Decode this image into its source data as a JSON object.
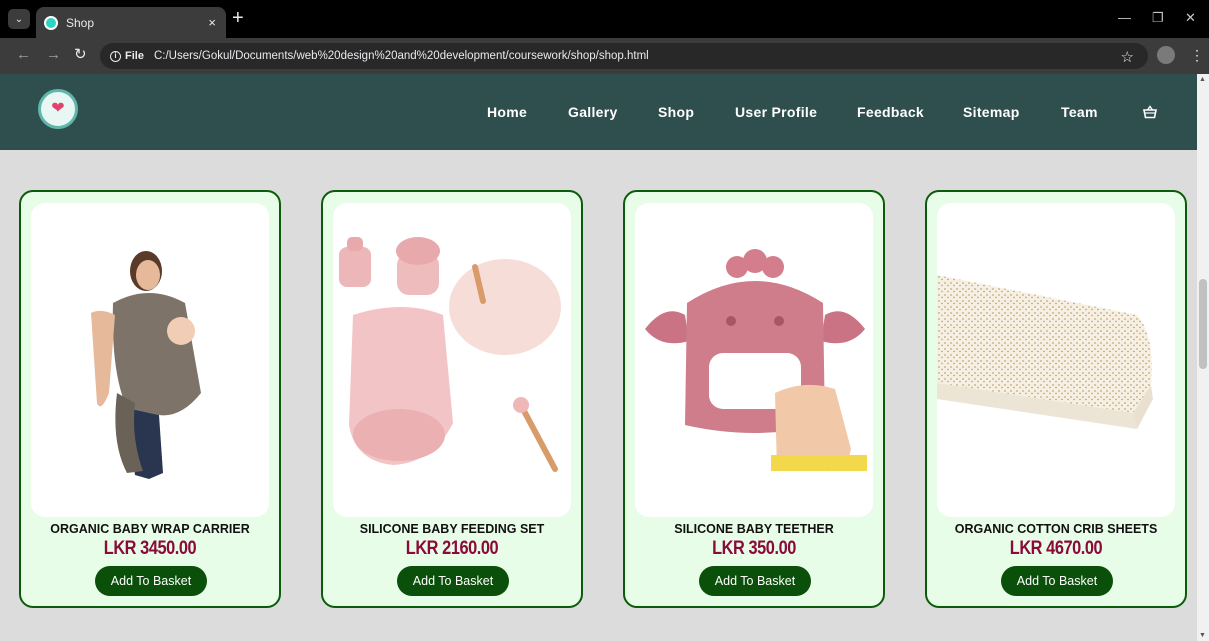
{
  "browser": {
    "tab_title": "Shop",
    "tab_close": "×",
    "new_tab": "+",
    "info_label": "File",
    "url": "C:/Users/Gokul/Documents/web%20design%20and%20development/coursework/shop/shop.html"
  },
  "site": {
    "nav": [
      "Home",
      "Gallery",
      "Shop",
      "User Profile",
      "Feedback",
      "Sitemap",
      "Team"
    ],
    "brand_colors": {
      "header": "#2f4f4f",
      "card_bg": "#e8fde8",
      "card_border": "#0a5c0a",
      "price": "#8b0a3a",
      "button": "#0a4f0a"
    }
  },
  "products": [
    {
      "name": "ORGANIC BABY WRAP CARRIER",
      "price": "LKR 3450.00",
      "button": "Add To Basket"
    },
    {
      "name": "SILICONE BABY FEEDING SET",
      "price": "LKR 2160.00",
      "button": "Add To Basket"
    },
    {
      "name": "SILICONE BABY TEETHER",
      "price": "LKR 350.00",
      "button": "Add To Basket"
    },
    {
      "name": "ORGANIC COTTON CRIB SHEETS",
      "price": "LKR 4670.00",
      "button": "Add To Basket"
    }
  ]
}
